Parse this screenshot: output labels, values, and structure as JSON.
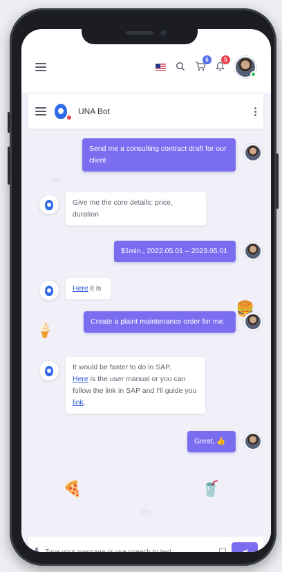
{
  "header": {
    "cart_count": "6",
    "notification_count": "5"
  },
  "chat": {
    "bot_name": "UNA Bot",
    "messages": [
      {
        "from": "user",
        "text": "Send me a consulting contract draft for our client"
      },
      {
        "from": "bot",
        "text": "Give me the core details: price, duration"
      },
      {
        "from": "user",
        "text": "$1mln., 2022.05.01 – 2023.05.01"
      },
      {
        "from": "bot",
        "link": "Here",
        "text": " it is"
      },
      {
        "from": "user",
        "text": "Create a plaint maintenance order for me."
      },
      {
        "from": "bot",
        "text_a": "It would be faster to do in SAP.",
        "link_a": "Here",
        "text_b": " is the user manual or you can follow the link in SAP and I'll guide you ",
        "link_b": "link",
        "text_c": "."
      },
      {
        "from": "user",
        "text": "Great,",
        "emoji": "👍"
      }
    ]
  },
  "input": {
    "placeholder": "Type your message or use speech to text"
  },
  "colors": {
    "accent": "#7b6df0",
    "badge_blue": "#4f6ee8",
    "badge_red": "#e8434f",
    "online": "#34c05a"
  },
  "icons": [
    "menu-icon",
    "us-flag-icon",
    "search-icon",
    "cart-icon",
    "bell-icon",
    "bot-logo-icon",
    "kebab-icon",
    "mic-icon",
    "document-icon",
    "send-icon"
  ]
}
